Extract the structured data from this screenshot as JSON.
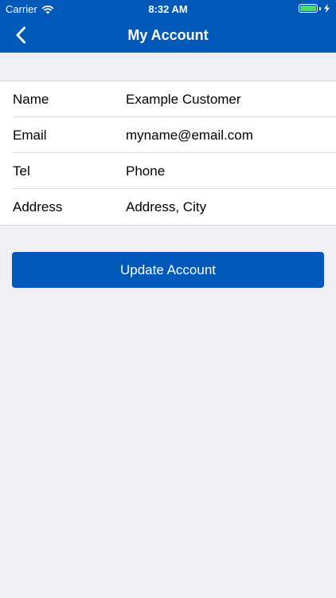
{
  "status_bar": {
    "carrier": "Carrier",
    "time": "8:32 AM",
    "wifi_icon": "wifi-icon",
    "battery_icon": "battery-icon",
    "battery_color": "#4cd964"
  },
  "nav": {
    "back_icon": "chevron-left-icon",
    "title": "My Account",
    "bar_color": "#0059b8"
  },
  "account_fields": [
    {
      "label": "Name",
      "value": "Example Customer"
    },
    {
      "label": "Email",
      "value": "myname@email.com"
    },
    {
      "label": "Tel",
      "value": "Phone"
    },
    {
      "label": "Address",
      "value": "Address, City"
    }
  ],
  "actions": {
    "update_label": "Update Account",
    "button_color": "#0059b8"
  }
}
